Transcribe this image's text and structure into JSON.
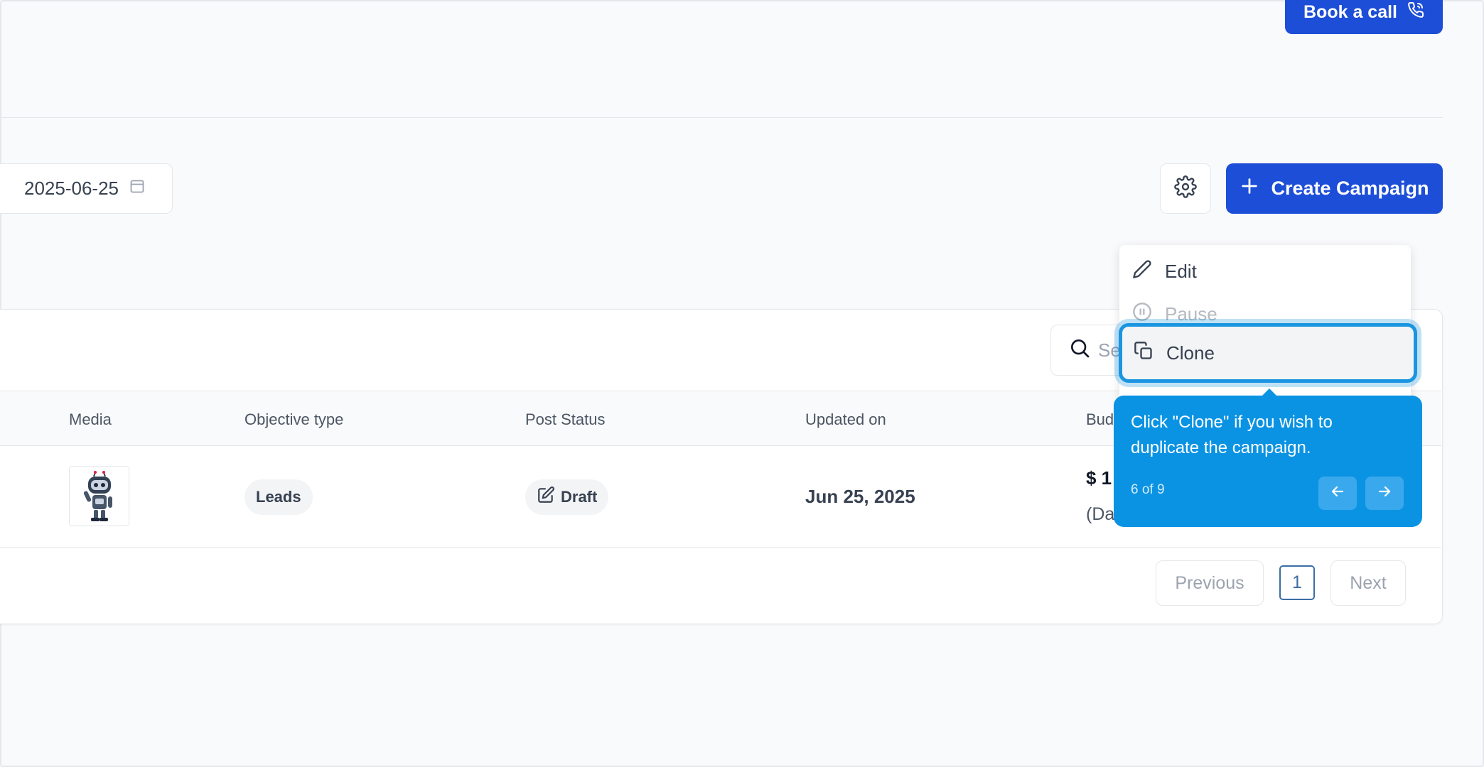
{
  "header": {
    "book_call_label": "Book a call"
  },
  "filters": {
    "date_value": "2025-06-25"
  },
  "toolbar": {
    "create_label": "Create Campaign"
  },
  "search": {
    "placeholder_visible": "Se"
  },
  "table": {
    "columns": [
      "Media",
      "Objective type",
      "Post Status",
      "Updated on",
      "Bud"
    ],
    "row": {
      "objective": "Leads",
      "status": "Draft",
      "updated": "Jun 25, 2025",
      "budget": "$ 1",
      "budget_sub": "(Da"
    }
  },
  "pagination": {
    "previous": "Previous",
    "current": "1",
    "next": "Next"
  },
  "menu": {
    "items": [
      {
        "label": "Edit",
        "icon": "pencil-icon",
        "disabled": false
      },
      {
        "label": "Pause",
        "icon": "pause-icon",
        "disabled": true
      },
      {
        "label": "Clone",
        "icon": "copy-icon",
        "disabled": false
      }
    ]
  },
  "tour": {
    "text": "Click \"Clone\" if you wish to duplicate the campaign.",
    "step": "6 of 9"
  },
  "colors": {
    "primary": "#1d4ed8",
    "tooltip": "#0b93e3",
    "highlight": "#1a95e0"
  }
}
